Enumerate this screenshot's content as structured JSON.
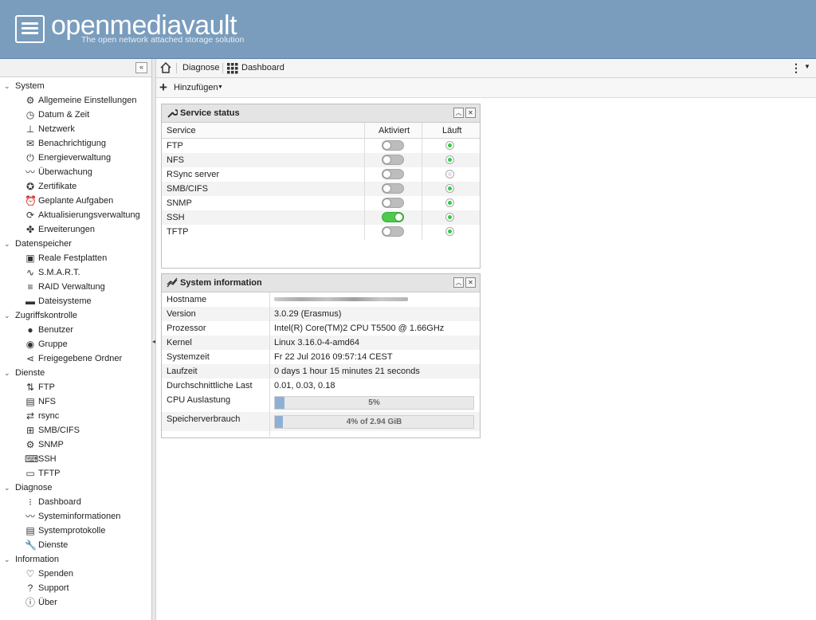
{
  "header": {
    "brand": "openmediavault",
    "tagline": "The open network attached storage solution"
  },
  "sidebar": {
    "groups": [
      {
        "label": "System",
        "items": [
          {
            "label": "Allgemeine Einstellungen",
            "icon": "gears-icon"
          },
          {
            "label": "Datum & Zeit",
            "icon": "clock-icon"
          },
          {
            "label": "Netzwerk",
            "icon": "network-icon"
          },
          {
            "label": "Benachrichtigung",
            "icon": "envelope-icon"
          },
          {
            "label": "Energieverwaltung",
            "icon": "power-icon"
          },
          {
            "label": "Überwachung",
            "icon": "chart-line-icon"
          },
          {
            "label": "Zertifikate",
            "icon": "certificate-icon"
          },
          {
            "label": "Geplante Aufgaben",
            "icon": "alarm-clock-icon"
          },
          {
            "label": "Aktualisierungsverwaltung",
            "icon": "update-icon"
          },
          {
            "label": "Erweiterungen",
            "icon": "puzzle-icon"
          }
        ]
      },
      {
        "label": "Datenspeicher",
        "items": [
          {
            "label": "Reale Festplatten",
            "icon": "disk-icon"
          },
          {
            "label": "S.M.A.R.T.",
            "icon": "pulse-icon"
          },
          {
            "label": "RAID Verwaltung",
            "icon": "database-icon"
          },
          {
            "label": "Dateisysteme",
            "icon": "folder-icon"
          }
        ]
      },
      {
        "label": "Zugriffskontrolle",
        "items": [
          {
            "label": "Benutzer",
            "icon": "user-icon"
          },
          {
            "label": "Gruppe",
            "icon": "users-icon"
          },
          {
            "label": "Freigegebene Ordner",
            "icon": "share-icon"
          }
        ]
      },
      {
        "label": "Dienste",
        "items": [
          {
            "label": "FTP",
            "icon": "ftp-icon"
          },
          {
            "label": "NFS",
            "icon": "nfs-icon"
          },
          {
            "label": "rsync",
            "icon": "rsync-icon"
          },
          {
            "label": "SMB/CIFS",
            "icon": "windows-icon"
          },
          {
            "label": "SNMP",
            "icon": "snmp-icon"
          },
          {
            "label": "SSH",
            "icon": "terminal-icon"
          },
          {
            "label": "TFTP",
            "icon": "monitor-icon"
          }
        ]
      },
      {
        "label": "Diagnose",
        "items": [
          {
            "label": "Dashboard",
            "icon": "grid-icon"
          },
          {
            "label": "Systeminformationen",
            "icon": "chart-line-icon"
          },
          {
            "label": "Systemprotokolle",
            "icon": "log-icon"
          },
          {
            "label": "Dienste",
            "icon": "wrench-icon"
          }
        ]
      },
      {
        "label": "Information",
        "items": [
          {
            "label": "Spenden",
            "icon": "heart-icon"
          },
          {
            "label": "Support",
            "icon": "question-icon"
          },
          {
            "label": "Über",
            "icon": "info-icon"
          }
        ]
      }
    ]
  },
  "breadcrumb": {
    "parent": "Diagnose",
    "current": "Dashboard"
  },
  "toolbar": {
    "add_label": "Hinzufügen"
  },
  "service_status": {
    "title": "Service status",
    "columns": [
      "Service",
      "Aktiviert",
      "Läuft"
    ],
    "rows": [
      {
        "name": "FTP",
        "enabled": false,
        "running": true
      },
      {
        "name": "NFS",
        "enabled": false,
        "running": true
      },
      {
        "name": "RSync server",
        "enabled": false,
        "running": false
      },
      {
        "name": "SMB/CIFS",
        "enabled": false,
        "running": true
      },
      {
        "name": "SNMP",
        "enabled": false,
        "running": true
      },
      {
        "name": "SSH",
        "enabled": true,
        "running": true
      },
      {
        "name": "TFTP",
        "enabled": false,
        "running": true
      }
    ]
  },
  "system_information": {
    "title": "System information",
    "rows": [
      {
        "key": "Hostname",
        "value": ""
      },
      {
        "key": "Version",
        "value": "3.0.29 (Erasmus)"
      },
      {
        "key": "Prozessor",
        "value": "Intel(R) Core(TM)2 CPU T5500 @ 1.66GHz"
      },
      {
        "key": "Kernel",
        "value": "Linux 3.16.0-4-amd64"
      },
      {
        "key": "Systemzeit",
        "value": "Fr 22 Jul 2016 09:57:14 CEST"
      },
      {
        "key": "Laufzeit",
        "value": "0 days 1 hour 15 minutes 21 seconds"
      },
      {
        "key": "Durchschnittliche Last",
        "value": "0.01, 0.03, 0.18"
      }
    ],
    "cpu": {
      "label": "CPU Auslastung",
      "text": "5%",
      "percent": 5
    },
    "memory": {
      "label": "Speicherverbrauch",
      "text": "4% of 2.94 GiB",
      "percent": 4
    }
  },
  "colors": {
    "header_bg": "#7a9dbe",
    "toggle_on": "#4ec94e",
    "running_dot": "#2fcc46",
    "progress_fill": "#8fb0d4"
  }
}
